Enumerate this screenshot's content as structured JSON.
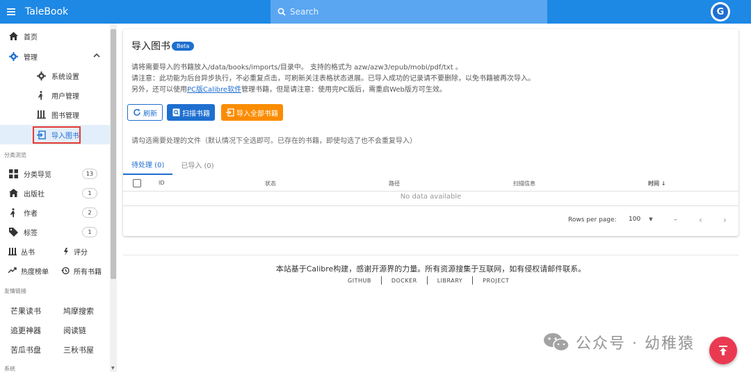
{
  "app": {
    "title": "TaleBook"
  },
  "search": {
    "placeholder": "Search"
  },
  "user": {
    "avatar_letter": "G"
  },
  "sidebar": {
    "home": "首页",
    "manage": "管理",
    "sub": {
      "settings": "系统设置",
      "users": "用户管理",
      "books": "图书管理",
      "import": "导入图书"
    },
    "section_browse": "分类浏览",
    "browse": [
      {
        "label": "分类导览",
        "count": "13",
        "icon": "grid-icon"
      },
      {
        "label": "出版社",
        "count": "1",
        "icon": "publisher-icon"
      },
      {
        "label": "作者",
        "count": "2",
        "icon": "author-icon"
      },
      {
        "label": "标签",
        "count": "1",
        "icon": "tag-icon"
      }
    ],
    "series": "丛书",
    "rating": "评分",
    "hot": "热度榜单",
    "allbooks": "所有书籍",
    "section_links": "友情链接",
    "links": [
      "芒果读书",
      "鸠摩搜索",
      "追更神器",
      "阅读链",
      "苦瓜书盘",
      "三秋书屋"
    ],
    "section_system": "系统"
  },
  "card": {
    "title": "导入图书",
    "beta": "Beta",
    "line1": "请将需要导入的书籍放入/data/books/imports/目录中。 支持的格式为 azw/azw3/epub/mobi/pdf/txt 。",
    "line2": "请注意：此功能为后台异步执行，不必重复点击，可刷新关注表格状态进展。已导入成功的记录请不要删除，以免书籍被再次导入。",
    "line3_pre": "另外，还可以使用",
    "line3_link": "PC版Calibre软件",
    "line3_post": "管理书籍，但是请注意：使用完PC版后，需重启Web版方可生效。",
    "btn_refresh": "刷新",
    "btn_scan": "扫描书籍",
    "btn_import_all": "导入全部书籍",
    "hint": "请勾选需要处理的文件（默认情况下全选即可。已存在的书籍，即使勾选了也不会重复导入）",
    "tabs": [
      "待处理 (0)",
      "已导入 (0)"
    ],
    "columns": [
      "ID",
      "状态",
      "路径",
      "扫描信息",
      "时间 ↓"
    ],
    "no_data": "No data available",
    "rows_per_page_label": "Rows per page:",
    "rows_per_page_value": "100",
    "range": "–"
  },
  "footer": {
    "text": "本站基于Calibre构建，感谢开源界的力量。所有资源搜集于互联网，如有侵权请邮件联系。",
    "links": [
      "GITHUB",
      "DOCKER",
      "LIBRARY",
      "PROJECT"
    ]
  },
  "watermark": "公众号 · 幼稚猿",
  "colors": {
    "primary": "#1e88e5",
    "accent": "#1e6fd0",
    "orange": "#fb8c00",
    "fab": "#ea3a52",
    "highlight": "#e53935"
  }
}
